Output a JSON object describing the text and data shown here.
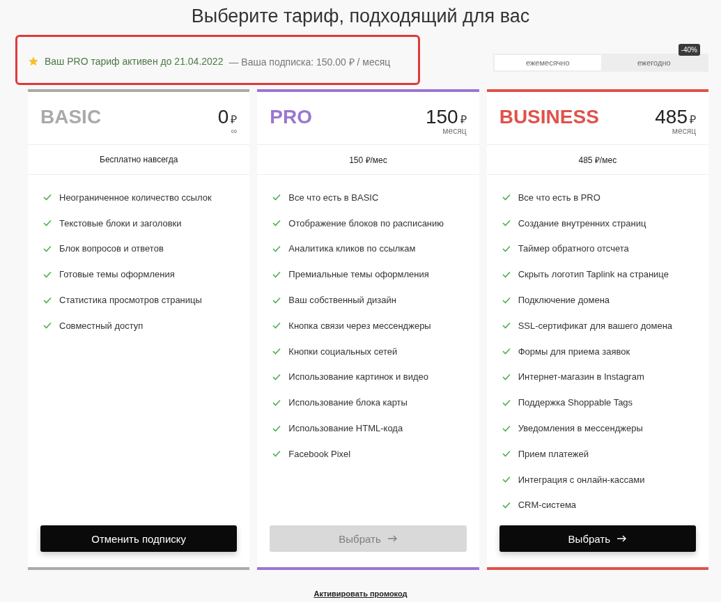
{
  "title": "Выберите тариф, подходящий для вас",
  "status_banner": {
    "active_text": "Ваш PRO тариф активен до 21.04.2022",
    "subscription_text": "— Ваша подписка: 150.00 ₽ / месяц",
    "highlighted": true
  },
  "billing_toggle": {
    "options": [
      {
        "label": "ежемесячно",
        "selected": true
      },
      {
        "label": "ежегодно",
        "selected": false
      }
    ],
    "badge": "-40%"
  },
  "plans": [
    {
      "name": "BASIC",
      "color": "#aaaaaa",
      "price": "0",
      "currency": "₽",
      "period": "∞",
      "subtitle": "Бесплатно навсегда",
      "features": [
        "Неограниченное количество ссылок",
        "Текстовые блоки и заголовки",
        "Блок вопросов и ответов",
        "Готовые темы оформления",
        "Статистика просмотров страницы",
        "Совместный доступ"
      ],
      "button": {
        "kind": "cancel",
        "label": "Отменить подписку",
        "disabled": false
      }
    },
    {
      "name": "PRO",
      "color": "#9a76d0",
      "price": "150",
      "currency": "₽",
      "period": "месяц",
      "subtitle": "150 ₽/мес",
      "features": [
        "Все что есть в BASIC",
        "Отображение блоков по расписанию",
        "Аналитика кликов по ссылкам",
        "Премиальные темы оформления",
        "Ваш собственный дизайн",
        "Кнопка связи через мессенджеры",
        "Кнопки социальных сетей",
        "Использование картинок и видео",
        "Использование блока карты",
        "Использование HTML-кода",
        "Facebook Pixel"
      ],
      "button": {
        "kind": "select",
        "label": "Выбрать",
        "disabled": true
      }
    },
    {
      "name": "BUSINESS",
      "color": "#e0524a",
      "price": "485",
      "currency": "₽",
      "period": "месяц",
      "subtitle": "485 ₽/мес",
      "features": [
        "Все что есть в PRO",
        "Создание внутренних страниц",
        "Таймер обратного отсчета",
        "Скрыть логотип Taplink на странице",
        "Подключение домена",
        "SSL-сертификат для вашего домена",
        "Формы для приема заявок",
        "Интернет-магазин в Instagram",
        "Поддержка Shoppable Tags",
        "Уведомления в мессенджеры",
        "Прием платежей",
        "Интеграция с онлайн-кассами",
        "CRM-система"
      ],
      "button": {
        "kind": "select",
        "label": "Выбрать",
        "disabled": false
      }
    }
  ],
  "promo_link": "Активировать промокод"
}
